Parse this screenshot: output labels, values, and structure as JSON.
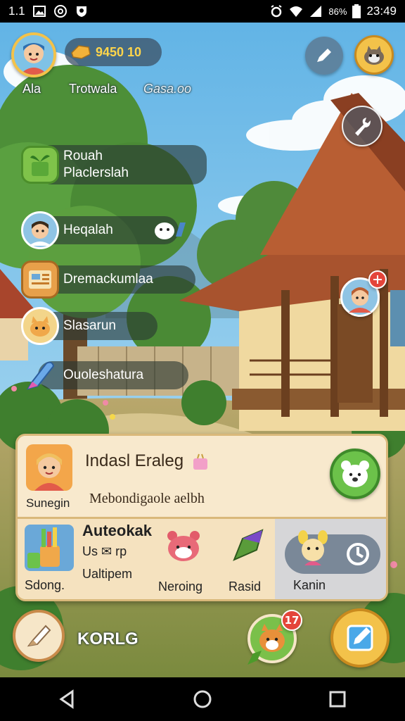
{
  "status_bar": {
    "left_text": "1.1",
    "battery": "86%",
    "time": "23:49"
  },
  "hud": {
    "coins": "9450 10",
    "label_player": "Ala",
    "label_title": "Trotwala",
    "label_extra": "Gasa.oo"
  },
  "menu": [
    {
      "label_line1": "Rouah",
      "label_line2": "Placlerslah",
      "icon": "bucket-plant-icon"
    },
    {
      "label_line1": "Heqalah",
      "icon": "boy-avatar-icon"
    },
    {
      "label_line1": "Dremackumlaa",
      "icon": "notebook-icon"
    },
    {
      "label_line1": "Slasarun",
      "icon": "cat-icon"
    },
    {
      "label_line1": "Ouoleshatura",
      "icon": "brush-icon"
    }
  ],
  "panel": {
    "title": "Indasl Eraleg",
    "subtitle": "Mebondigaole aelbh",
    "caption": "Sunegin",
    "items": [
      {
        "name_line1": "Auteokak",
        "name_line2": "Us ✉ rp",
        "name_line3": "Ualtipem",
        "caption": "Sdong."
      },
      {
        "caption": "Neroing"
      },
      {
        "caption": "Rasid"
      },
      {
        "caption": "Kanin"
      }
    ]
  },
  "bottom_bar": {
    "label": "KORLG",
    "badge": "17"
  },
  "colors": {
    "sky": "#87c5ea",
    "gold": "#f3c24a",
    "panel": "#f6e6c8",
    "green_btn": "#6cc24a"
  }
}
